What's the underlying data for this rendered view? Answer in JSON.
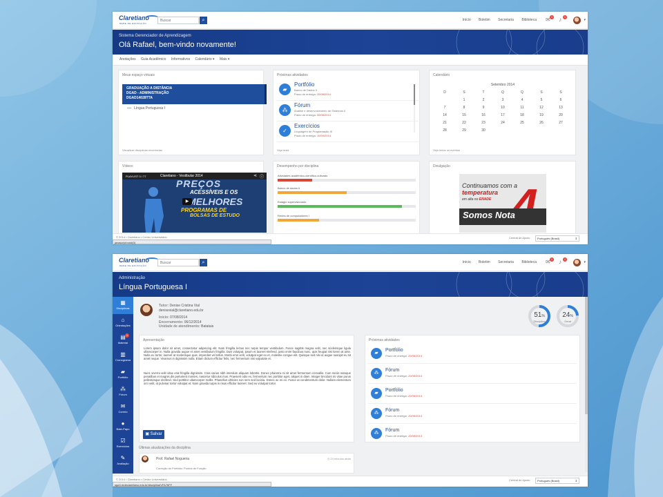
{
  "colors": {
    "brand": "#1f4e9c",
    "accent": "#2f7ed8",
    "badge": "#e8453c",
    "banner": "#1c4396"
  },
  "topbar": {
    "logo_name": "Claretiano",
    "logo_tag": "REDE DE EDUCAÇÃO",
    "search_placeholder": "Buscar",
    "nav": [
      "Início",
      "Boletim",
      "Secretaria",
      "Biblioteca"
    ],
    "mail_badge": "1",
    "bell_badge": "1"
  },
  "s1": {
    "banner_sub": "Sistema Gerenciador de Aprendizagem",
    "banner_title": "Olá Rafael, bem-vindo novamente!",
    "menu": [
      "Anotações",
      "Guia Acadêmico",
      "Informativos",
      "Calendário ▾",
      "Mais ▾"
    ],
    "space": {
      "title": "Meus espaço virtuais",
      "lines": [
        "GRADUAÇÃO A DISTÂNCIA",
        "DGAD - ADMINISTRAÇÃO",
        "DGAD14028TTA"
      ],
      "subject": "Língua Portuguesa I",
      "link": "Visualizar disciplinas encerradas"
    },
    "activities": {
      "title": "Próximas atividades",
      "deadline_label": "Prazo de entrega:",
      "items": [
        {
          "icon": "folder-icon",
          "title": "Portfólio",
          "desc": "Banco de Dados II",
          "date": "20/08/2014"
        },
        {
          "icon": "forum-icon",
          "title": "Fórum",
          "desc": "Análise e desenvolvimento de Sistemas II",
          "date": "30/08/2014"
        },
        {
          "icon": "check-icon",
          "title": "Exercícios",
          "desc": "Linguagem de Programação III",
          "date": "10/09/2014"
        }
      ],
      "link": "Veja mais"
    },
    "calendar": {
      "title": "Calendário",
      "month": "Setembro 2014",
      "weekdays": [
        "D",
        "S",
        "T",
        "Q",
        "Q",
        "S",
        "S"
      ],
      "weeks": [
        [
          "",
          "1",
          "2",
          "3",
          "4",
          "5",
          "6"
        ],
        [
          "7",
          "8",
          "9",
          "10",
          "11",
          "12",
          "13"
        ],
        [
          "14",
          "15",
          "16",
          "17",
          "18",
          "19",
          "20"
        ],
        [
          "21",
          "22",
          "23",
          "24",
          "25",
          "26",
          "27"
        ],
        [
          "28",
          "29",
          "30",
          "",
          "",
          "",
          ""
        ]
      ],
      "link": "Veja todos os eventos"
    },
    "videos": {
      "title": "Vídeos",
      "playlist": "PLAYLIST",
      "count": "0 / 77",
      "video_title": "Claretiano - Vestibular 2014",
      "w1": "PREÇOS",
      "w2": "ACESSÍVEIS E OS",
      "w3": "MELHORES",
      "w4": "PROGRAMAS DE",
      "w5": "BOLSAS DE ESTUDO"
    },
    "performance": {
      "title": "Desempenho por disciplina",
      "items": [
        {
          "label": "Atividades acadêmico-científico-culturais",
          "value": 0.25,
          "color": "#d64a3a"
        },
        {
          "label": "Banco de dados II",
          "value": 0.5,
          "color": "#f0a63a"
        },
        {
          "label": "Estágio supervisionado",
          "value": 0.9,
          "color": "#5cb85c"
        },
        {
          "label": "Redes de computadores I",
          "value": 0.3,
          "color": "#f0a63a"
        }
      ]
    },
    "divulgacao": {
      "title": "Divulgação",
      "a1": "Continuamos com a",
      "a2": "temperatura",
      "a3": "em alta no",
      "a3b": "ENADE",
      "a4": "Somos Nota",
      "n4": "4"
    },
    "footer": {
      "copyright": "© 2014 • Claretiano • Centro Universitário",
      "status": "javascript:void(0)",
      "help": "Central de Ajuda:",
      "lang": "Português (Brasil)"
    }
  },
  "s2": {
    "banner_sub": "Administração",
    "banner_title": "Língua Portuguesa I",
    "side": [
      {
        "icon": "grid-icon",
        "label": "Disciplinas",
        "glyph": "▦",
        "active": true
      },
      {
        "icon": "home-icon",
        "label": "Orientações",
        "glyph": "⌂"
      },
      {
        "icon": "file-icon",
        "label": "Material",
        "glyph": "▤",
        "badge": "1"
      },
      {
        "icon": "calendar-icon",
        "label": "Cronograma",
        "glyph": "▥"
      },
      {
        "icon": "folder-icon",
        "label": "Portfólio",
        "glyph": "▰"
      },
      {
        "icon": "forum-icon",
        "label": "Fórum",
        "glyph": "⁂"
      },
      {
        "icon": "mail-icon",
        "label": "Correio",
        "glyph": "✉"
      },
      {
        "icon": "chat-icon",
        "label": "Bate-Papo",
        "glyph": "●"
      },
      {
        "icon": "check-icon",
        "label": "Exercícios",
        "glyph": "☑"
      },
      {
        "icon": "edit-icon",
        "label": "Avaliação",
        "glyph": "✎"
      }
    ],
    "profile": {
      "tutor_label": "Tutor:",
      "tutor": "Denise Cristina Vial",
      "email": "denisevial@claretiano.edu.br",
      "start_label": "Início:",
      "start": "07/08/2014",
      "end_label": "Encerramento:",
      "end": "06/12/2014",
      "unit_label": "Unidade de atendimento:",
      "unit": "Batatais"
    },
    "donuts": [
      {
        "value": "51",
        "pct": 0.51,
        "caption": "Disciplina"
      },
      {
        "value": "24",
        "pct": 0.24,
        "caption": "Geral"
      }
    ],
    "presentation": {
      "title": "Apresentação",
      "p1": "Lorem ipsum dolor sit amet, consectetur adipiscing elit. Nam fringilla lectus nec turpis tempor vestibulum. Fusce sagittis magna velit, nec scelerisque ligula ullamcorper in. Nulla gravida augue et amet vestibulum fringilla. Duis volutpat, ipsum et laoreet eleifend, justo enim faucibus nunc, quis feugiat nisi lorem at ante. Nulla eu tortor, laoreet at scelerisque quis, imperdiet vel tellus. Morbi eros velit, volutpat eget ex et, molestie congue elit. Quisque sed nisi ut augue suscipit eu sit amet neque. Vivamus in dignissim nulla. Etiam dictum efficitur felis, nec fermentum nisi vulputate et.",
      "p2": "Nunc viverra velit vitae erat fringilla dignissim. Cras varius nibh interdum aliquam lobortis. Donec pharetra mi sit amet fermentum convallis. Cum sociis natoque penatibus et magnis dis parturient montes, nascetur ridiculus mus. Praesent odio ex, fermentum nec porttitor eget, aliquet in diam. Integer tincidunt mi vitae purus pellentesque eleifend. Sed porttitor ullamcorper mollis. Phasellus ultricies non sem sed lacinia. Donec ac mi ex. Fusce at condimentum dolor. Nullam elementum orci velit, id pulvinar tortor volutpat et. Nam gravida turpis in risus efficitur laoreet. Sed eu volutpat tortor.",
      "save": "Salvar"
    },
    "activities": {
      "title": "Próximas atividades",
      "deadline_label": "Prazo de entrega:",
      "items": [
        {
          "icon": "folder-icon",
          "title": "Portfólio",
          "date": "20/08/2014"
        },
        {
          "icon": "forum-icon",
          "title": "Fórum",
          "date": "20/08/2014"
        },
        {
          "icon": "folder-icon",
          "title": "Portfólio",
          "date": "20/08/2014"
        },
        {
          "icon": "forum-icon",
          "title": "Fórum",
          "date": "20/08/2014"
        },
        {
          "icon": "forum-icon",
          "title": "Fórum",
          "date": "20/08/2014"
        }
      ]
    },
    "updates": {
      "title": "Últimas atualizações da disciplina",
      "name": "Prof. Rafael Nogueira",
      "time": "24 minutos atrás",
      "content": "Correção do Portfólio: Pontos de Função"
    },
    "footer": {
      "copyright": "© 2014 • Claretiano • Centro Universitário",
      "status": "sga3.redeclaretiano.edu.br/disciplina/VFA76FF",
      "help": "Central de Ajuda:",
      "lang": "Português (Brasil)"
    }
  }
}
